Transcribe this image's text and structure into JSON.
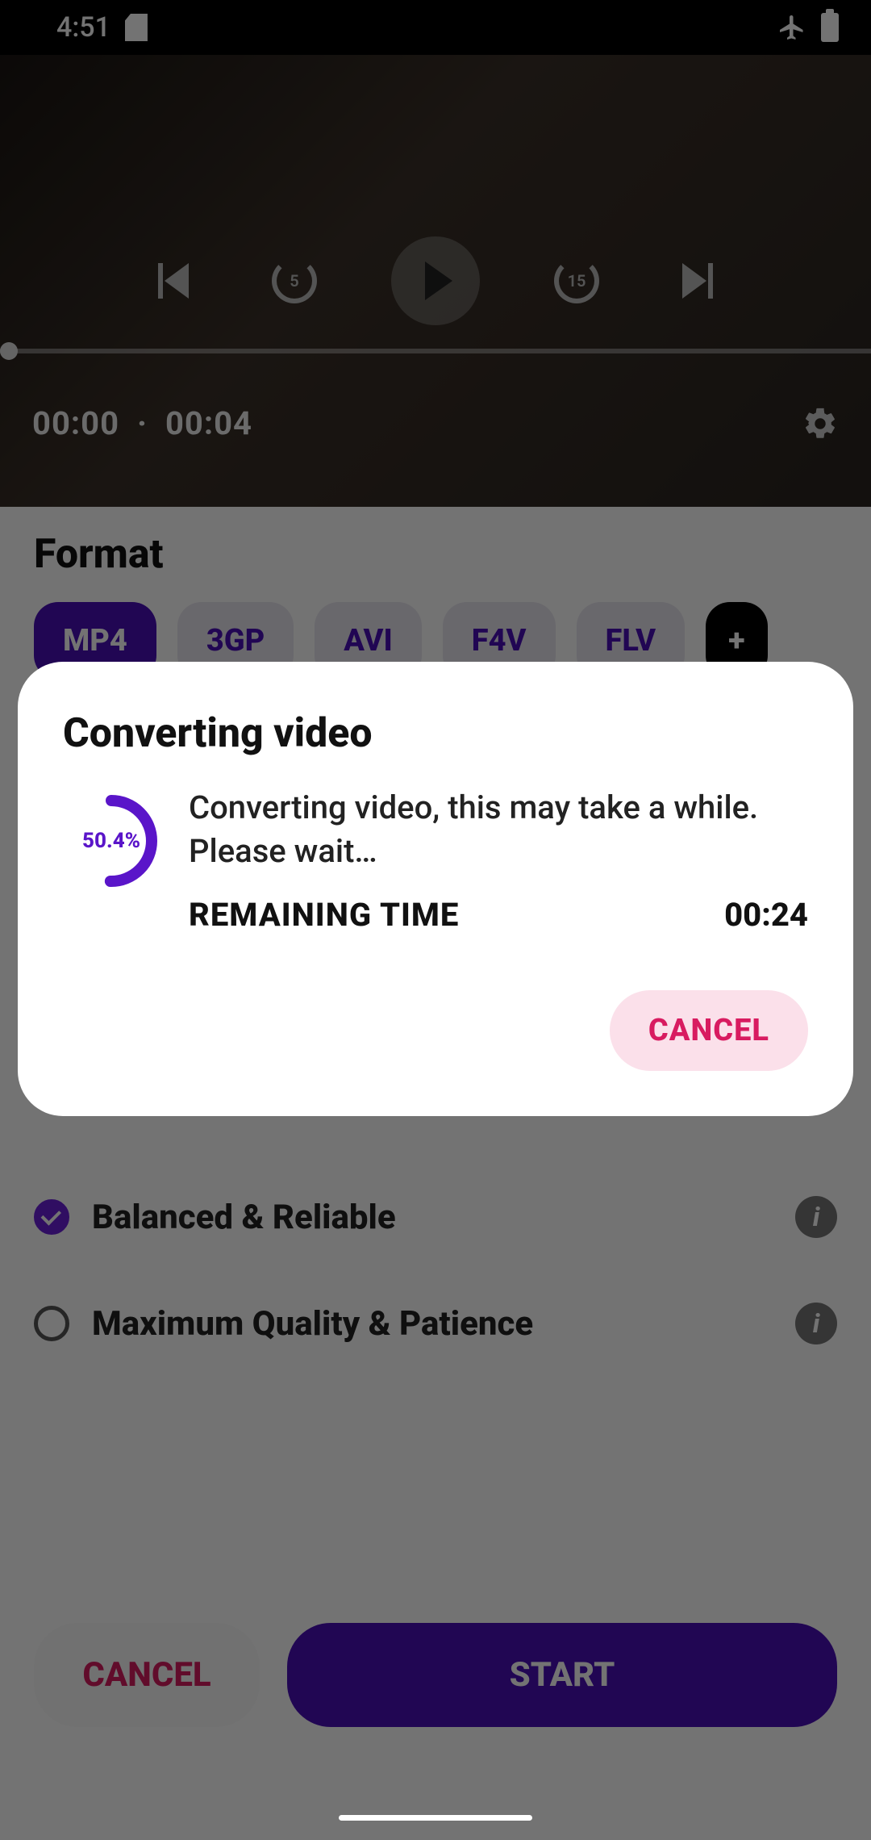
{
  "status": {
    "time": "4:51"
  },
  "player": {
    "rewind_label": "5",
    "forward_label": "15",
    "current_time": "00:00",
    "separator": "·",
    "duration": "00:04"
  },
  "format": {
    "section_title": "Format",
    "formats": [
      "MP4",
      "3GP",
      "AVI",
      "F4V",
      "FLV"
    ],
    "more": "+"
  },
  "options": {
    "balanced": "Balanced & Reliable",
    "max_quality": "Maximum Quality & Patience"
  },
  "actions": {
    "cancel": "CANCEL",
    "start": "START"
  },
  "dialog": {
    "title": "Converting video",
    "progress_pct": "50.4%",
    "progress_value": 50.4,
    "message": "Converting video, this may take a while. Please wait…",
    "remaining_label": "REMAINING TIME",
    "remaining_value": "00:24",
    "cancel": "CANCEL"
  }
}
